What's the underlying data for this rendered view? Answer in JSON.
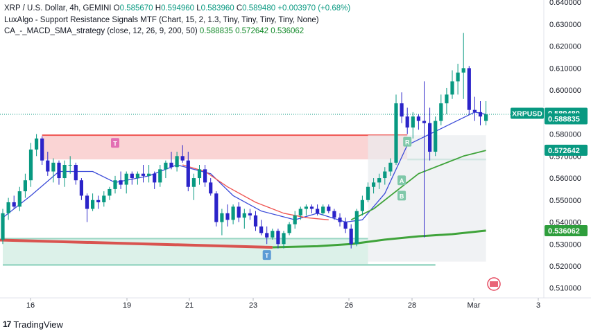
{
  "legend": {
    "symbol_line": "XRP / U.S. Dollar, 4h, GEMINI",
    "ohlc": {
      "o_label": "O",
      "o_value": "0.585670",
      "h_label": "H",
      "h_value": "0.594960",
      "l_label": "L",
      "l_value": "0.583960",
      "c_label": "C",
      "c_value": "0.589480",
      "change": "+0.003970 (+0.68%)"
    },
    "indicator1": "LuxAlgo - Support Resistance Signals MTF (Chart, 15, 2, 1.3, Tiny, Tiny, Tiny, Tiny, None)",
    "indicator2_name": "CA_-_MACD_SMA_strategy (close, 12, 26, 9, 200, 50)",
    "indicator2_values": [
      "0.588835",
      "0.572642",
      "0.536062"
    ]
  },
  "footer": {
    "brand": "TradingView"
  },
  "colors": {
    "up_candle": "#089981",
    "down_candle": "#2b24c9",
    "resistance_zone": "#f9cccc",
    "resistance_line": "#ef5350",
    "support_zone": "#d6efe5",
    "support_line": "#9ad6c4",
    "sma_fast": "#3b4bd8",
    "sma_red": "#ef5350",
    "sma_green": "#3fa33a",
    "price_tag": "#089981"
  },
  "chart_data": {
    "type": "candlestick",
    "symbol": "XRPUSD",
    "timeframe": "4h",
    "y_axis": {
      "ticks": [
        "0.640000",
        "0.630000",
        "0.620000",
        "0.610000",
        "0.600000",
        "0.590000",
        "0.580000",
        "0.570000",
        "0.560000",
        "0.550000",
        "0.540000",
        "0.530000",
        "0.520000",
        "0.510000"
      ],
      "range": [
        0.5055,
        0.641
      ]
    },
    "x_axis": {
      "ticks": [
        "16",
        "19",
        "21",
        "23",
        "26",
        "28",
        "Mar",
        "3"
      ]
    },
    "price_labels": [
      {
        "text": "XRPUSD",
        "value": "0.589480",
        "y": 0.58948
      },
      {
        "text": "",
        "value": "0.588835",
        "y": 0.588835
      },
      {
        "text": "",
        "value": "0.572642",
        "y": 0.572642
      },
      {
        "text": "",
        "value": "0.536062",
        "y": 0.536062
      }
    ],
    "candles": [
      [
        0.532,
        0.546,
        0.53,
        0.544
      ],
      [
        0.544,
        0.551,
        0.541,
        0.549
      ],
      [
        0.549,
        0.552,
        0.546,
        0.547
      ],
      [
        0.547,
        0.556,
        0.545,
        0.554
      ],
      [
        0.554,
        0.562,
        0.551,
        0.559
      ],
      [
        0.559,
        0.576,
        0.556,
        0.573
      ],
      [
        0.573,
        0.58,
        0.57,
        0.578
      ],
      [
        0.578,
        0.579,
        0.566,
        0.568
      ],
      [
        0.568,
        0.572,
        0.561,
        0.563
      ],
      [
        0.563,
        0.569,
        0.558,
        0.567
      ],
      [
        0.567,
        0.568,
        0.557,
        0.56
      ],
      [
        0.56,
        0.568,
        0.556,
        0.566
      ],
      [
        0.566,
        0.57,
        0.562,
        0.566
      ],
      [
        0.566,
        0.567,
        0.557,
        0.559
      ],
      [
        0.559,
        0.56,
        0.55,
        0.552
      ],
      [
        0.552,
        0.553,
        0.54,
        0.546
      ],
      [
        0.546,
        0.553,
        0.545,
        0.55
      ],
      [
        0.55,
        0.552,
        0.546,
        0.549
      ],
      [
        0.549,
        0.554,
        0.547,
        0.552
      ],
      [
        0.552,
        0.556,
        0.55,
        0.555
      ],
      [
        0.555,
        0.561,
        0.553,
        0.559
      ],
      [
        0.559,
        0.563,
        0.555,
        0.557
      ],
      [
        0.557,
        0.563,
        0.553,
        0.562
      ],
      [
        0.562,
        0.563,
        0.557,
        0.56
      ],
      [
        0.56,
        0.563,
        0.557,
        0.562
      ],
      [
        0.562,
        0.566,
        0.558,
        0.561
      ],
      [
        0.561,
        0.566,
        0.558,
        0.562
      ],
      [
        0.562,
        0.563,
        0.555,
        0.558
      ],
      [
        0.558,
        0.566,
        0.556,
        0.564
      ],
      [
        0.564,
        0.568,
        0.56,
        0.567
      ],
      [
        0.567,
        0.572,
        0.564,
        0.565
      ],
      [
        0.565,
        0.572,
        0.563,
        0.57
      ],
      [
        0.57,
        0.575,
        0.567,
        0.568
      ],
      [
        0.568,
        0.572,
        0.554,
        0.556
      ],
      [
        0.556,
        0.562,
        0.55,
        0.56
      ],
      [
        0.56,
        0.566,
        0.557,
        0.564
      ],
      [
        0.564,
        0.566,
        0.556,
        0.558
      ],
      [
        0.558,
        0.56,
        0.552,
        0.553
      ],
      [
        0.553,
        0.554,
        0.538,
        0.54
      ],
      [
        0.54,
        0.546,
        0.534,
        0.544
      ],
      [
        0.544,
        0.548,
        0.538,
        0.541
      ],
      [
        0.541,
        0.548,
        0.539,
        0.547
      ],
      [
        0.547,
        0.549,
        0.54,
        0.542
      ],
      [
        0.542,
        0.546,
        0.537,
        0.544
      ],
      [
        0.544,
        0.546,
        0.541,
        0.543
      ],
      [
        0.543,
        0.545,
        0.536,
        0.538
      ],
      [
        0.538,
        0.541,
        0.534,
        0.535
      ],
      [
        0.535,
        0.538,
        0.53,
        0.533
      ],
      [
        0.533,
        0.537,
        0.532,
        0.536
      ],
      [
        0.536,
        0.537,
        0.528,
        0.53
      ],
      [
        0.53,
        0.536,
        0.528,
        0.535
      ],
      [
        0.535,
        0.54,
        0.534,
        0.539
      ],
      [
        0.539,
        0.545,
        0.537,
        0.543
      ],
      [
        0.543,
        0.547,
        0.541,
        0.546
      ],
      [
        0.546,
        0.548,
        0.543,
        0.547
      ],
      [
        0.547,
        0.548,
        0.544,
        0.546
      ],
      [
        0.546,
        0.548,
        0.543,
        0.544
      ],
      [
        0.544,
        0.548,
        0.543,
        0.547
      ],
      [
        0.547,
        0.548,
        0.544,
        0.545
      ],
      [
        0.545,
        0.546,
        0.541,
        0.542
      ],
      [
        0.542,
        0.544,
        0.538,
        0.54
      ],
      [
        0.54,
        0.542,
        0.535,
        0.537
      ],
      [
        0.537,
        0.539,
        0.528,
        0.53
      ],
      [
        0.53,
        0.546,
        0.529,
        0.545
      ],
      [
        0.545,
        0.552,
        0.543,
        0.55
      ],
      [
        0.55,
        0.558,
        0.549,
        0.556
      ],
      [
        0.556,
        0.56,
        0.553,
        0.558
      ],
      [
        0.558,
        0.562,
        0.555,
        0.56
      ],
      [
        0.56,
        0.565,
        0.557,
        0.563
      ],
      [
        0.563,
        0.569,
        0.561,
        0.567
      ],
      [
        0.567,
        0.598,
        0.566,
        0.594
      ],
      [
        0.594,
        0.599,
        0.585,
        0.588
      ],
      [
        0.588,
        0.592,
        0.58,
        0.583
      ],
      [
        0.583,
        0.59,
        0.578,
        0.588
      ],
      [
        0.588,
        0.589,
        0.582,
        0.586
      ],
      [
        0.586,
        0.604,
        0.533,
        0.585
      ],
      [
        0.585,
        0.592,
        0.568,
        0.572
      ],
      [
        0.572,
        0.588,
        0.57,
        0.586
      ],
      [
        0.586,
        0.598,
        0.584,
        0.594
      ],
      [
        0.594,
        0.601,
        0.589,
        0.598
      ],
      [
        0.598,
        0.609,
        0.596,
        0.604
      ],
      [
        0.604,
        0.612,
        0.598,
        0.608
      ],
      [
        0.608,
        0.626,
        0.596,
        0.61
      ],
      [
        0.61,
        0.611,
        0.589,
        0.591
      ],
      [
        0.591,
        0.597,
        0.586,
        0.59
      ],
      [
        0.59,
        0.595,
        0.584,
        0.588
      ],
      [
        0.586,
        0.595,
        0.584,
        0.589
      ]
    ],
    "series": [
      {
        "type": "line",
        "color": "sma_fast",
        "values": [
          [
            0,
            0.542
          ],
          [
            5,
            0.552
          ],
          [
            10,
            0.563
          ],
          [
            16,
            0.563
          ],
          [
            20,
            0.558
          ],
          [
            26,
            0.561
          ],
          [
            31,
            0.566
          ],
          [
            37,
            0.562
          ],
          [
            41,
            0.552
          ],
          [
            46,
            0.545
          ],
          [
            52,
            0.541
          ],
          [
            56,
            0.544
          ],
          [
            61,
            0.54
          ],
          [
            64,
            0.541
          ],
          [
            68,
            0.553
          ],
          [
            72,
            0.575
          ],
          [
            76,
            0.58
          ],
          [
            80,
            0.585
          ],
          [
            84,
            0.59
          ],
          [
            86,
            0.589
          ]
        ]
      },
      {
        "type": "line",
        "color": "sma_green",
        "values": [
          [
            62,
            0.541
          ],
          [
            66,
            0.546
          ],
          [
            70,
            0.554
          ],
          [
            74,
            0.562
          ],
          [
            78,
            0.566
          ],
          [
            82,
            0.57
          ],
          [
            86,
            0.5726
          ]
        ]
      },
      {
        "type": "line",
        "color": "sma_red",
        "values": [
          [
            32,
            0.566
          ],
          [
            36,
            0.563
          ],
          [
            40,
            0.556
          ],
          [
            45,
            0.549
          ],
          [
            50,
            0.544
          ],
          [
            54,
            0.542
          ],
          [
            58,
            0.541
          ]
        ]
      },
      {
        "type": "line",
        "color": "sma_green",
        "values": [
          [
            48,
            0.5285
          ],
          [
            56,
            0.529
          ],
          [
            62,
            0.53
          ],
          [
            68,
            0.532
          ],
          [
            74,
            0.5335
          ],
          [
            80,
            0.5345
          ],
          [
            86,
            0.5361
          ]
        ]
      }
    ],
    "zones": [
      {
        "kind": "resistance",
        "from": 7,
        "to": 72,
        "top": 0.5795,
        "bottom": 0.5685
      },
      {
        "kind": "support",
        "from": 0,
        "to": 65,
        "top": 0.5325,
        "bottom": 0.5205
      },
      {
        "kind": "support-line",
        "from": 72,
        "to": 86,
        "value": 0.5685
      },
      {
        "kind": "support-line",
        "from": 0,
        "to": 77,
        "value": 0.5205
      }
    ],
    "markers": [
      {
        "label": "T",
        "x": 20,
        "y": 0.576,
        "color": "#e36fb3"
      },
      {
        "label": "T",
        "x": 47,
        "y": 0.525,
        "color": "#5b9bd5"
      },
      {
        "label": "R",
        "x": 72,
        "y": 0.5765,
        "color": "#7fc8a9"
      },
      {
        "label": "A",
        "x": 71,
        "y": 0.559,
        "color": "#7fc8a9"
      },
      {
        "label": "B",
        "x": 71,
        "y": 0.552,
        "color": "#7fc8a9"
      }
    ]
  }
}
